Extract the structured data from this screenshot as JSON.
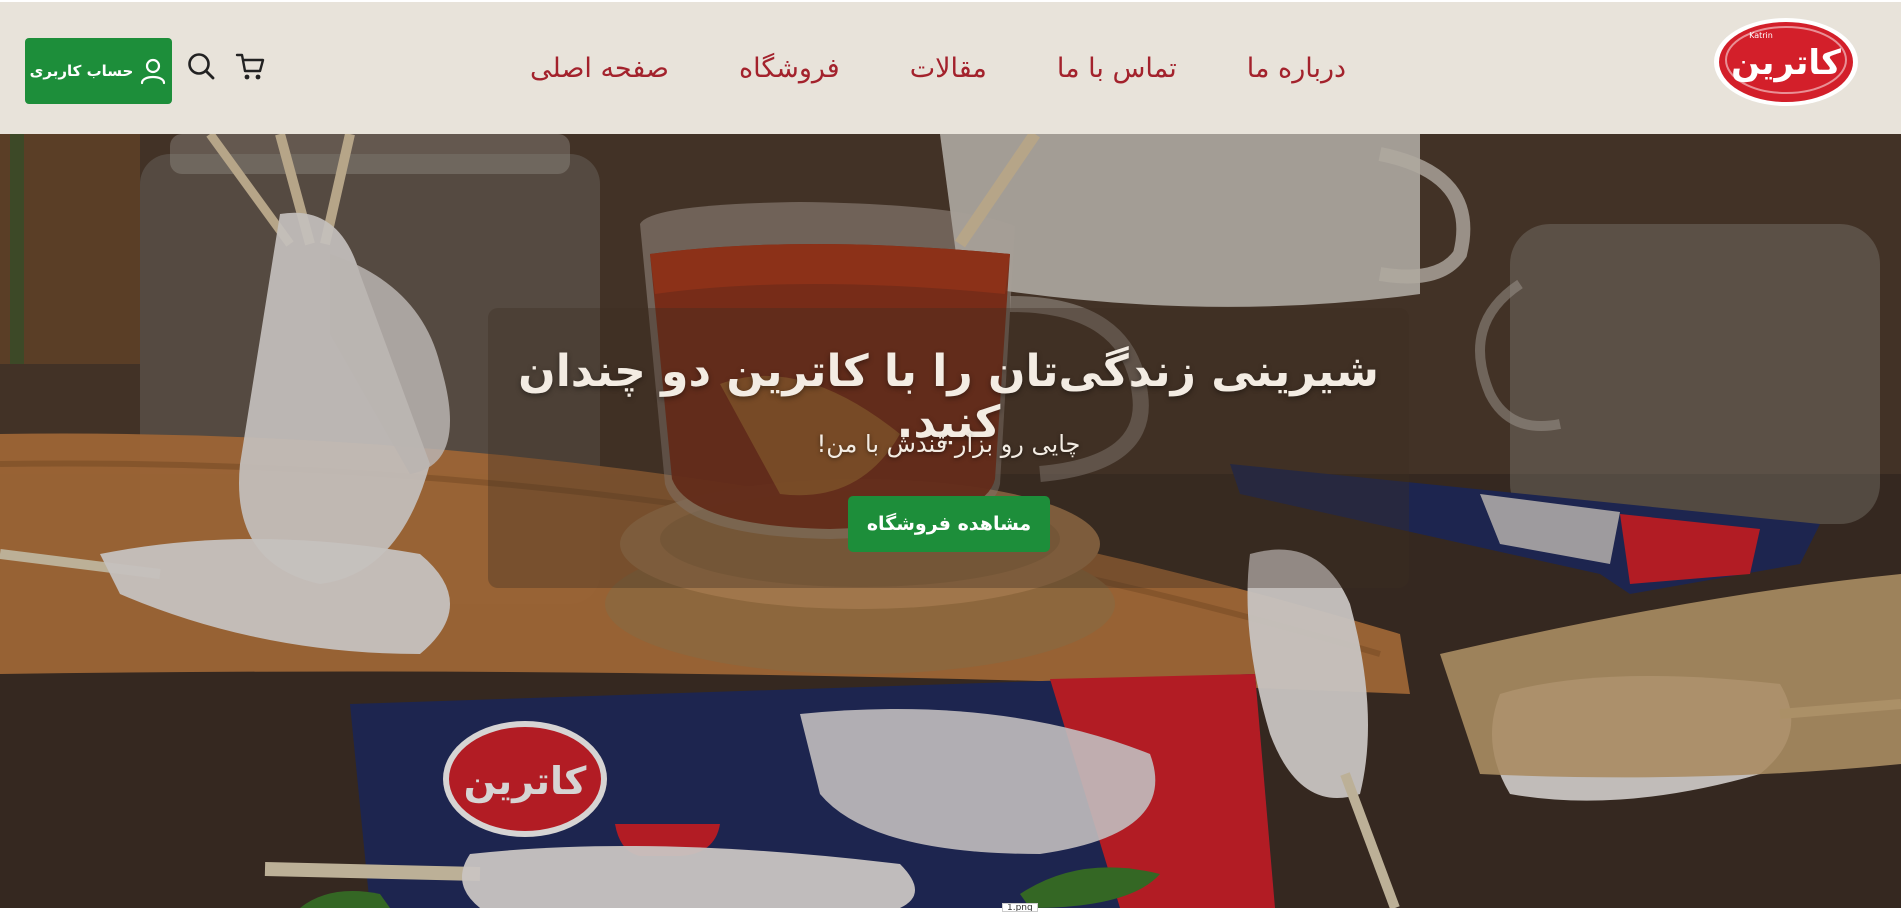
{
  "header": {
    "logo_text": "کاترین",
    "logo_subtext": "Katrin",
    "nav": [
      {
        "label": "صفحه اصلی"
      },
      {
        "label": "فروشگاه"
      },
      {
        "label": "مقالات"
      },
      {
        "label": "تماس با ما"
      },
      {
        "label": "درباره ما"
      }
    ],
    "account_label": "حساب کاربری",
    "icons": [
      "user-icon",
      "search-icon",
      "cart-icon"
    ]
  },
  "hero": {
    "title": "شیرینی زندگی‌تان را با کاترین دو چندان کنید.",
    "subtitle": "چایی رو بزار قندش با من!",
    "button_label": "مشاهده فروشگاه",
    "package_logo": "کاترین"
  },
  "caption": "1.png",
  "colors": {
    "header_bg": "#e8e3da",
    "nav_text": "#a3222c",
    "button_green": "#1d8e3a",
    "brand_red": "#d31f2a",
    "package_blue": "#1e2a5e"
  }
}
